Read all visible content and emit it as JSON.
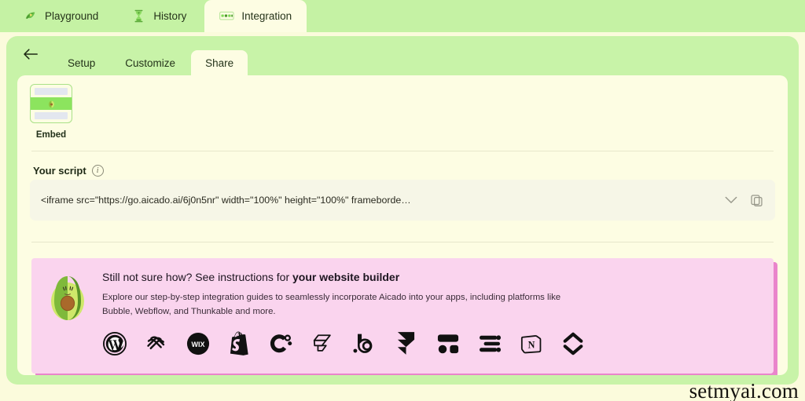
{
  "app": {
    "watermark": "setmyai.com",
    "colors": {
      "page_bg": "#fbfbdc",
      "green_panel": "#c8f3a8",
      "topbar": "#c5f2a4",
      "card": "#fdfde3",
      "banner_bg": "#fad4ee",
      "banner_shadow": "#e985cb",
      "embed_band": "#8ce45e"
    }
  },
  "topbar": {
    "tabs": [
      {
        "label": "Playground",
        "icon": "avocado-leaf-icon",
        "active": false
      },
      {
        "label": "History",
        "icon": "hourglass-icon",
        "active": false
      },
      {
        "label": "Integration",
        "icon": "embed-window-icon",
        "active": true
      }
    ]
  },
  "subnav": {
    "back_icon": "arrow-left-icon",
    "tabs": [
      {
        "label": "Setup",
        "active": false
      },
      {
        "label": "Customize",
        "active": false
      },
      {
        "label": "Share",
        "active": true
      }
    ]
  },
  "share": {
    "embed_card": {
      "label": "Embed",
      "icon": "embed-preview-icon"
    },
    "script": {
      "label": "Your script",
      "info_icon": "info-icon",
      "value": "<iframe src=\"https://go.aicado.ai/6j0n5nr\" width=\"100%\" height=\"100%\" frameborde…",
      "expand_icon": "chevron-down-icon",
      "copy_icon": "copy-icon"
    }
  },
  "banner": {
    "mascot_icon": "avocado-mascot-icon",
    "title_prefix": "Still not sure how? See instructions for ",
    "title_strong": "your website builder",
    "description": "Explore our step-by-step integration guides to seamlessly incorporate Aicado into your apps, including platforms like Bubble, Webflow, and Thunkable and more.",
    "platforms": [
      {
        "name": "WordPress",
        "icon": "wordpress-icon"
      },
      {
        "name": "Squarespace",
        "icon": "squarespace-icon"
      },
      {
        "name": "Wix",
        "icon": "wix-icon"
      },
      {
        "name": "Shopify",
        "icon": "shopify-icon"
      },
      {
        "name": "Duda",
        "icon": "duda-icon"
      },
      {
        "name": "Webflow",
        "icon": "webflow-icon"
      },
      {
        "name": "Bubble",
        "icon": "bubble-icon"
      },
      {
        "name": "Framer",
        "icon": "framer-icon"
      },
      {
        "name": "Dorik",
        "icon": "dorik-icon"
      },
      {
        "name": "Thunkable",
        "icon": "thunkable-icon"
      },
      {
        "name": "Notion",
        "icon": "notion-icon"
      },
      {
        "name": "Softr",
        "icon": "softr-icon"
      }
    ]
  }
}
